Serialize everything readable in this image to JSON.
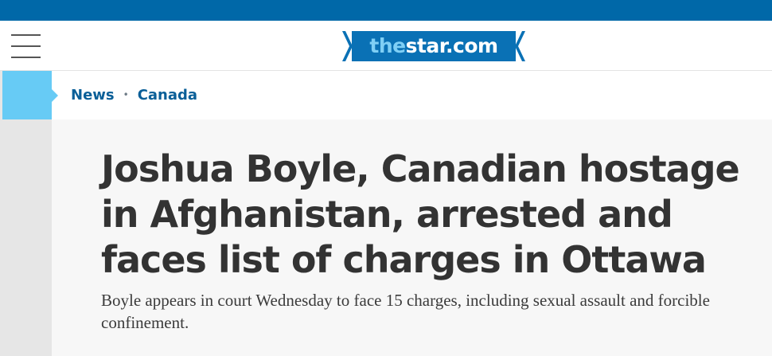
{
  "site": {
    "logo_prefix": "the",
    "logo_suffix": "star.com",
    "colors": {
      "brand_blue": "#0068a8",
      "logo_blue": "#0a71b5",
      "logo_accent": "#7fcff5",
      "section_tab": "#67cbf5",
      "link_blue": "#0a5f98"
    }
  },
  "header": {
    "menu_icon": "hamburger-menu-icon"
  },
  "breadcrumb": {
    "items": [
      "News",
      "Canada"
    ],
    "separator": "•"
  },
  "article": {
    "headline": "Joshua Boyle, Canadian hostage in Afghanistan, arrested and faces list of charges in Ottawa",
    "subhead": "Boyle appears in court Wednesday to face 15 charges, including sexual assault and forcible confinement."
  }
}
